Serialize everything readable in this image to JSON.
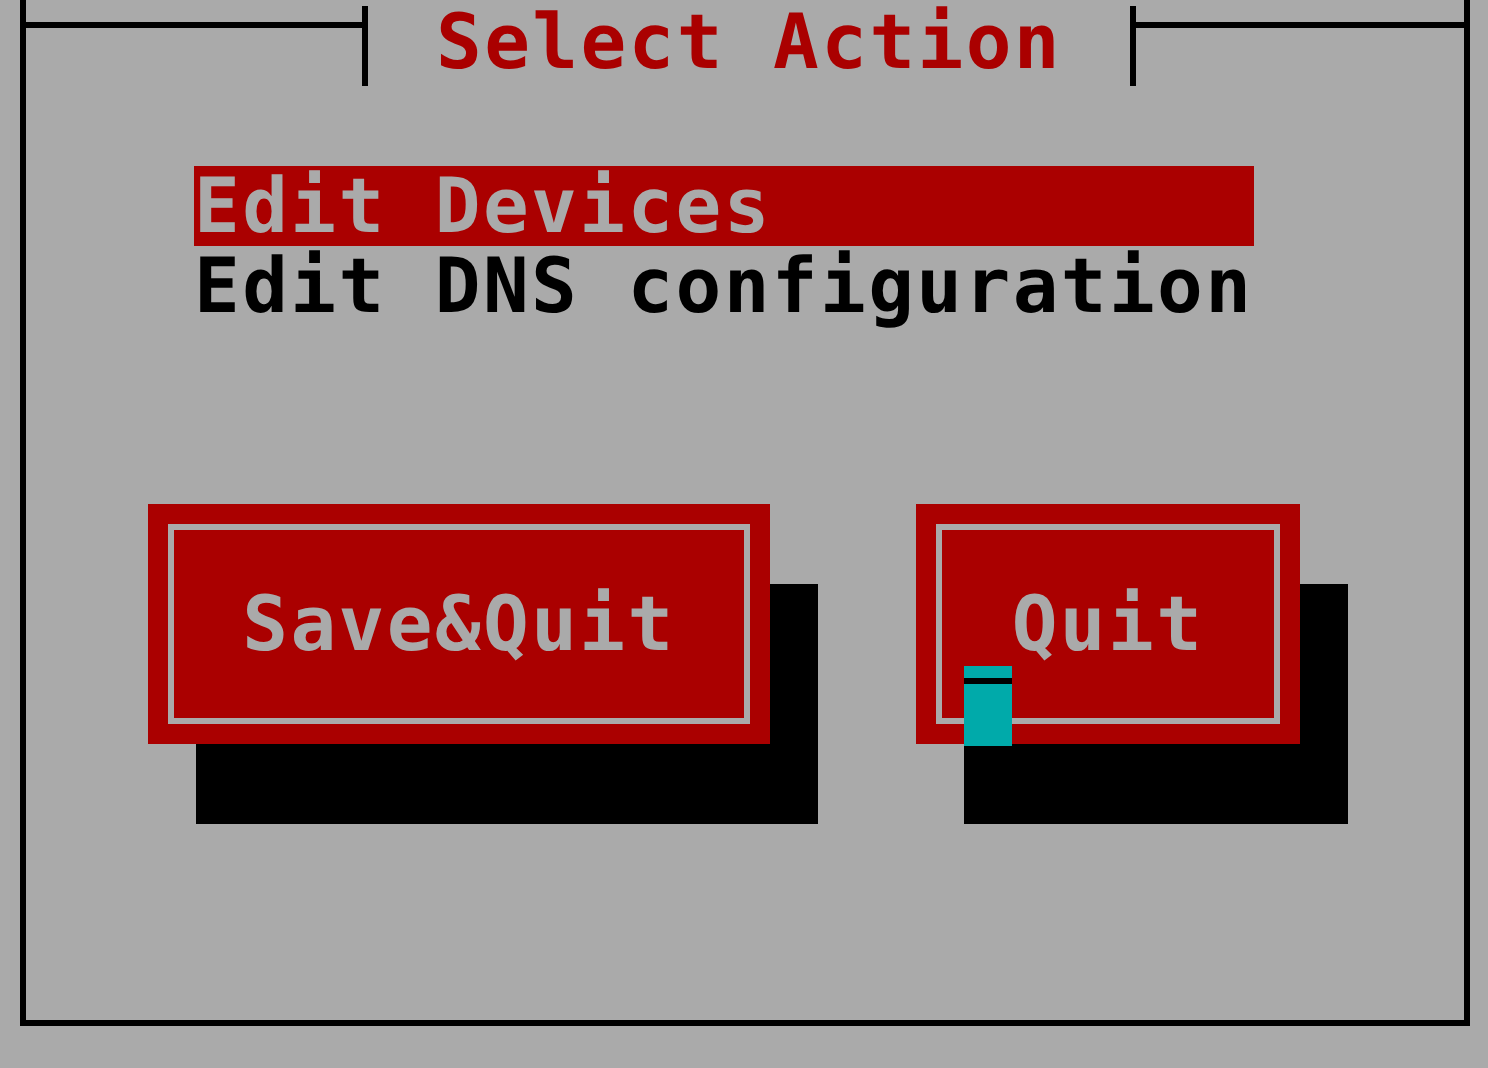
{
  "dialog": {
    "title": "Select Action"
  },
  "menu": {
    "items": [
      {
        "label": "Edit Devices",
        "selected": true
      },
      {
        "label": "Edit DNS configuration",
        "selected": false
      }
    ]
  },
  "buttons": [
    {
      "label": "Save&Quit"
    },
    {
      "label": "Quit"
    }
  ]
}
